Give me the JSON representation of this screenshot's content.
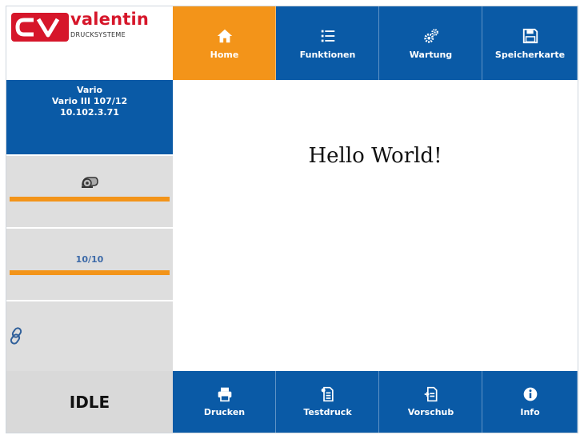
{
  "brand": {
    "name": "valentin",
    "subtitle": "DRUCKSYSTEME",
    "mark_letters": "CV",
    "colors": {
      "red": "#d6162a",
      "blue": "#0a5aa6",
      "orange": "#f39419"
    }
  },
  "nav": [
    {
      "label": "Home",
      "icon": "home-icon",
      "active": true
    },
    {
      "label": "Funktionen",
      "icon": "list-icon",
      "active": false
    },
    {
      "label": "Wartung",
      "icon": "gears-icon",
      "active": false
    },
    {
      "label": "Speicherkarte",
      "icon": "save-icon",
      "active": false
    }
  ],
  "device": {
    "line1": "Vario",
    "line2": "Vario III 107/12",
    "line3": "10.102.3.71"
  },
  "panels": {
    "roll_icon": "label-roll-icon",
    "count": "10/10",
    "link_icon": "link-icon"
  },
  "content": {
    "text": "Hello World!"
  },
  "status": "IDLE",
  "footer": [
    {
      "label": "Drucken",
      "icon": "printer-icon"
    },
    {
      "label": "Testdruck",
      "icon": "test-print-icon"
    },
    {
      "label": "Vorschub",
      "icon": "feed-icon"
    },
    {
      "label": "Info",
      "icon": "info-icon"
    }
  ]
}
